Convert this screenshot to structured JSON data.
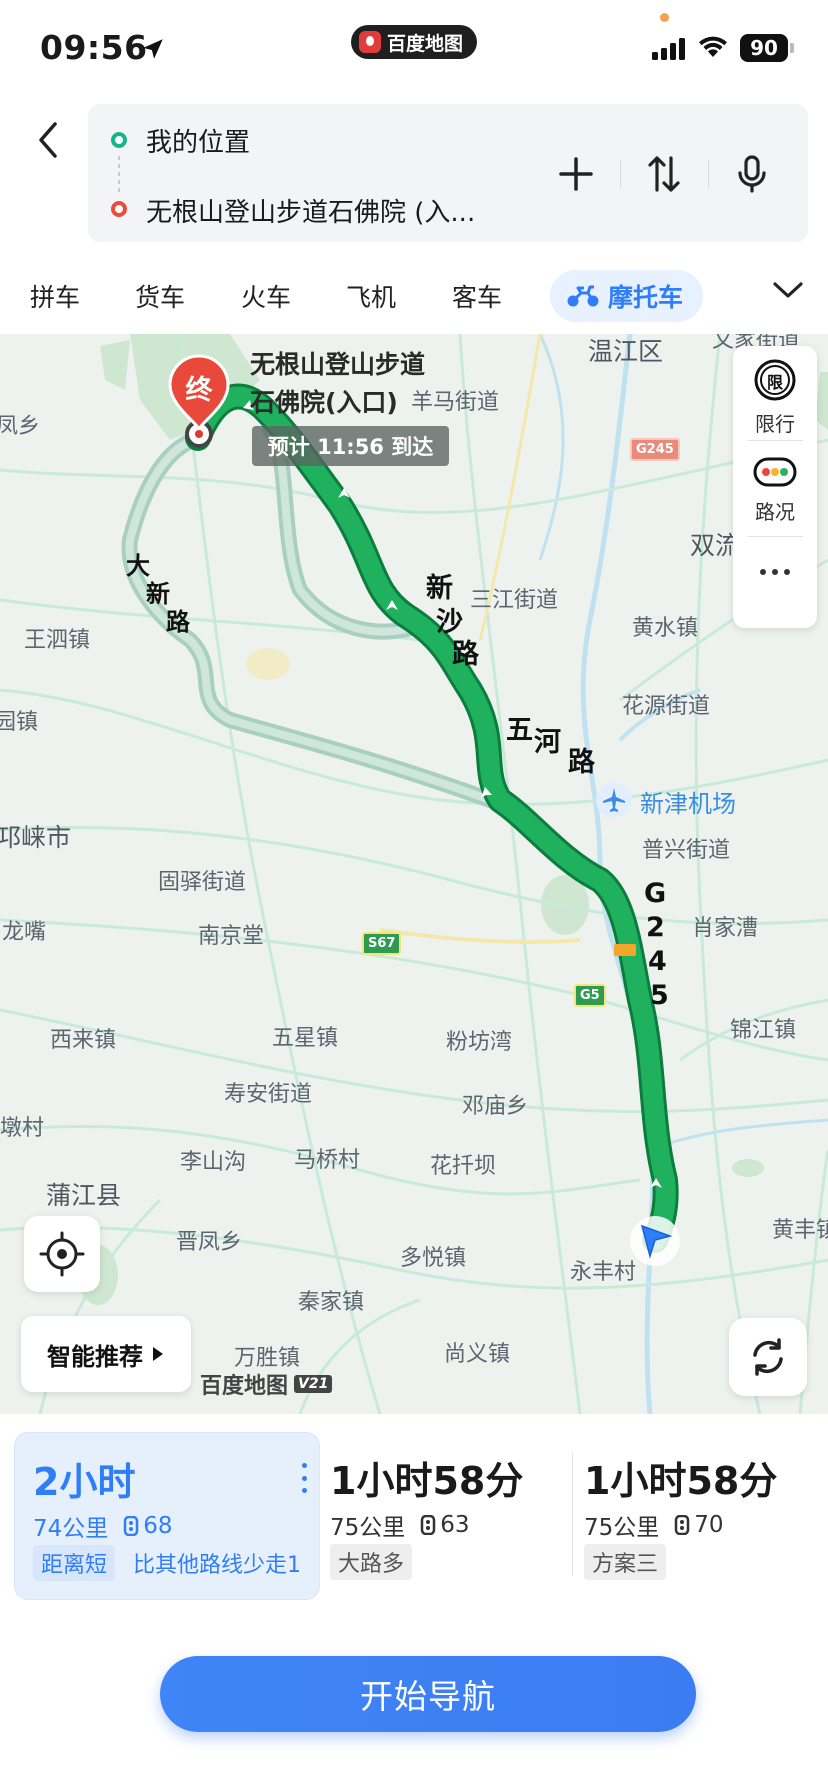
{
  "status_bar": {
    "time": "09:56",
    "battery": "90",
    "pill_app_name": "百度地图"
  },
  "search": {
    "start": "我的位置",
    "destination": "无根山登山步道石佛院 (入..."
  },
  "tabs": [
    {
      "label": "拼车"
    },
    {
      "label": "货车"
    },
    {
      "label": "火车"
    },
    {
      "label": "飞机"
    },
    {
      "label": "客车"
    },
    {
      "label": "摩托车",
      "active": true
    }
  ],
  "map": {
    "destination_marker": "终",
    "destination_title": "无根山登山步道\n石佛院(入口)",
    "eta": "预计 11:56 到达",
    "road_labels": {
      "xinsha": [
        "新",
        "沙",
        "路"
      ],
      "wuhe": [
        "五",
        "河",
        "路"
      ],
      "g245": [
        "G",
        "2",
        "4",
        "5"
      ],
      "daxin": [
        "大",
        "新",
        "路"
      ]
    },
    "shields": {
      "g245": "G245",
      "s67": "S67",
      "g5": "G5"
    },
    "places": {
      "wenjiang": "温江区",
      "wenjia": "文家街道",
      "yangma": "羊马街道",
      "fengxiang": "凤乡",
      "shuangliu": "双流",
      "sanjiang": "三江街道",
      "huangshui": "黄水镇",
      "wangsi": "王泗镇",
      "yuanzhen": "园镇",
      "huayuan": "花源街道",
      "xinjin_airport": "新津机场",
      "puxing": "普兴街道",
      "qionglai": "邛崃市",
      "guyi": "固驿街道",
      "longzui": "龙嘴",
      "nanjingtang": "南京堂",
      "xiaojiacao": "肖家漕",
      "xilai": "西来镇",
      "wuxing": "五星镇",
      "fenfangwan": "粉坊湾",
      "jinjiang": "锦江镇",
      "shouan": "寿安街道",
      "dengmiao": "邓庙乡",
      "duncun": "墩村",
      "lishangou": "李山沟",
      "maqiaocun": "马桥村",
      "huaqianba": "花扦坝",
      "pujiang": "蒲江县",
      "huangfeng": "黄丰镇",
      "jinfeng": "晋凤乡",
      "duoyue": "多悦镇",
      "yongfeng": "永丰村",
      "qinjia": "秦家镇",
      "wansheng": "万胜镇",
      "shangyi": "尚义镇"
    },
    "side_panel": {
      "limit_icon": "限",
      "limit": "限行",
      "traffic": "路况"
    },
    "smart_recommend": "智能推荐",
    "watermark": "百度地图",
    "watermark_version": "V21"
  },
  "plans": [
    {
      "time": "2小时",
      "distance": "74公里",
      "lights": "68",
      "tag": "距离短",
      "desc": "比其他路线少走1"
    },
    {
      "time": "1小时58分",
      "distance": "75公里",
      "lights": "63",
      "tag": "大路多"
    },
    {
      "time": "1小时58分",
      "distance": "75公里",
      "lights": "70",
      "tag": "方案三"
    }
  ],
  "start_nav": "开始导航",
  "colors": {
    "accent_blue": "#2f7ef8",
    "route_green": "#19a15a",
    "alt_route": "#a9cfc2"
  },
  "icons": [
    "location-arrow-icon",
    "back-icon",
    "add-icon",
    "swap-icon",
    "mic-icon",
    "motorcycle-icon",
    "chevron-down-icon",
    "locate-icon",
    "refresh-icon",
    "navigation-arrow-icon",
    "traffic-light-icon"
  ]
}
